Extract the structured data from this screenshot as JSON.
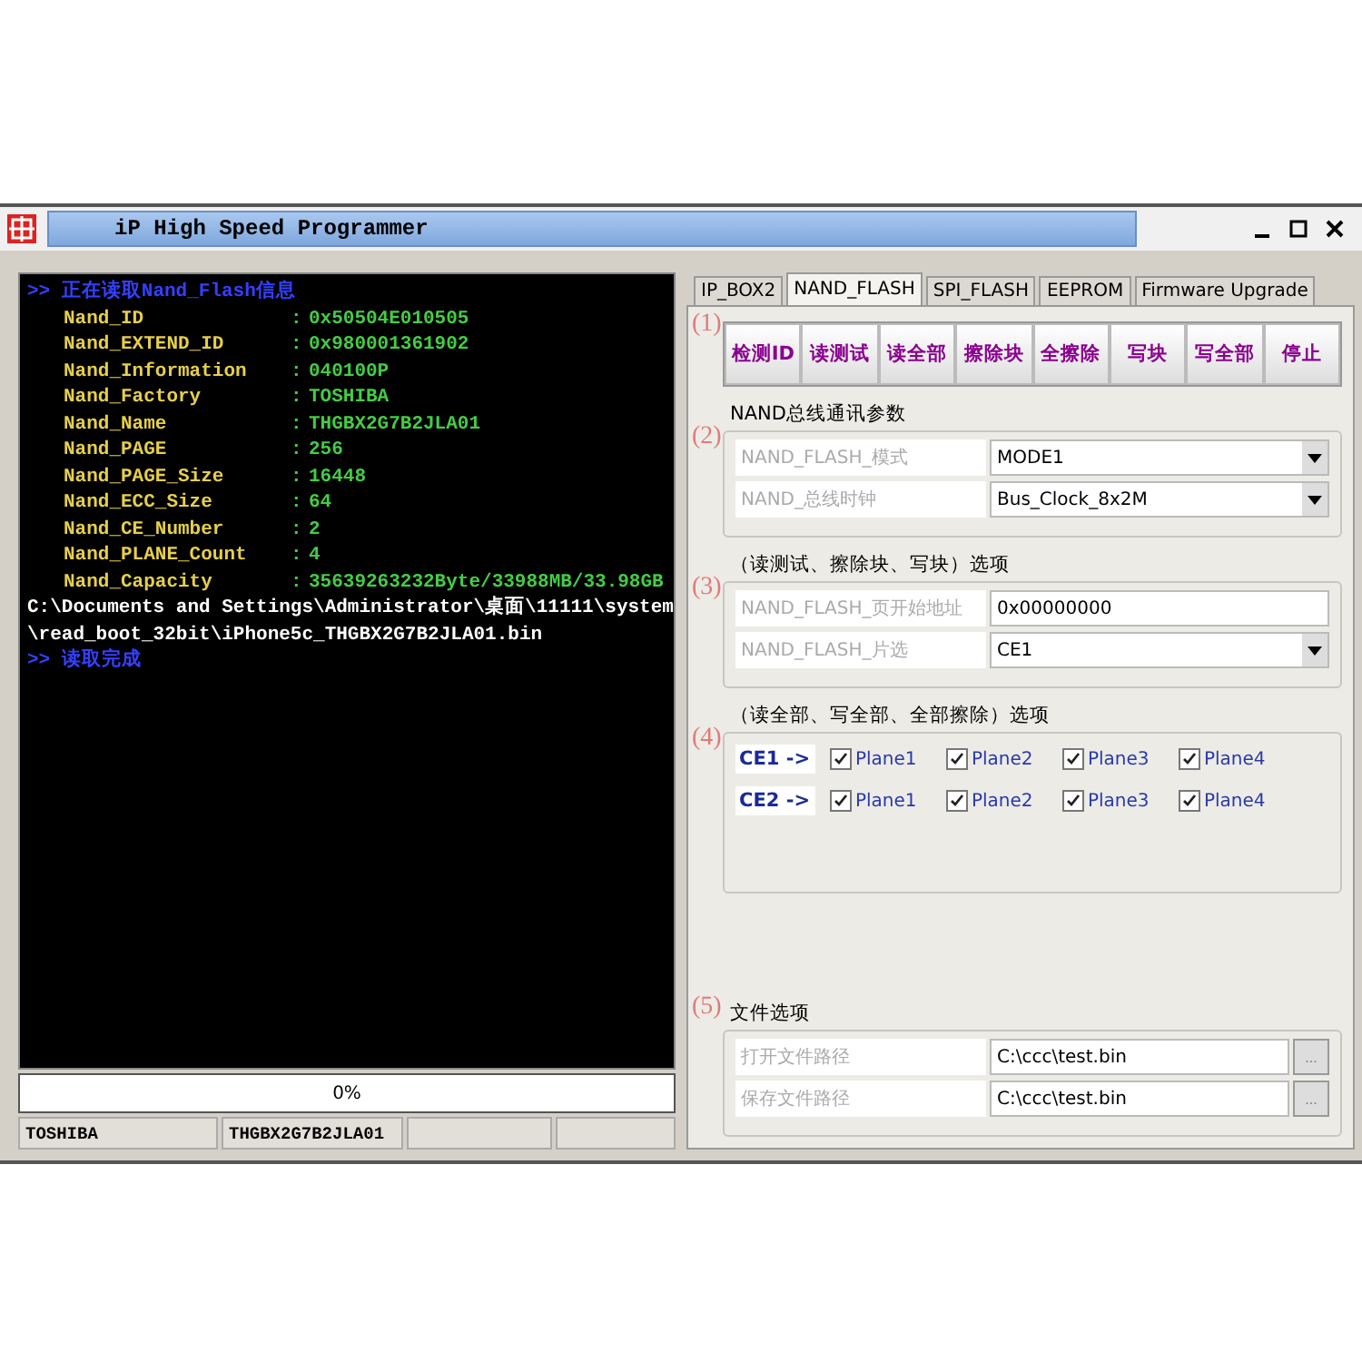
{
  "window": {
    "title": "iP High Speed Programmer"
  },
  "console": {
    "lines": [
      {
        "kind": "message",
        "text": ">> 正在读取Nand_Flash信息"
      },
      {
        "kind": "field",
        "label": "Nand_ID",
        "sep": ":",
        "value": "0x50504E010505"
      },
      {
        "kind": "field",
        "label": "Nand_EXTEND_ID",
        "sep": ":",
        "value": "0x980001361902"
      },
      {
        "kind": "field",
        "label": "Nand_Information",
        "sep": ":",
        "value": "040100P"
      },
      {
        "kind": "field",
        "label": "Nand_Factory",
        "sep": ":",
        "value": "TOSHIBA"
      },
      {
        "kind": "field",
        "label": "Nand_Name",
        "sep": ":",
        "value": "THGBX2G7B2JLA01"
      },
      {
        "kind": "field",
        "label": "Nand_PAGE",
        "sep": ":",
        "value": "256"
      },
      {
        "kind": "field",
        "label": "Nand_PAGE_Size",
        "sep": ":",
        "value": "16448"
      },
      {
        "kind": "field",
        "label": "Nand_ECC_Size",
        "sep": ":",
        "value": "64"
      },
      {
        "kind": "field",
        "label": "Nand_CE_Number",
        "sep": ":",
        "value": "2"
      },
      {
        "kind": "field",
        "label": "Nand_PLANE_Count",
        "sep": ":",
        "value": "4"
      },
      {
        "kind": "field",
        "label": "Nand_Capacity",
        "sep": ":",
        "value": "35639263232Byte/33988MB/33.98GB"
      },
      {
        "kind": "path",
        "text": "C:\\Documents and Settings\\Administrator\\桌面\\11111\\system"
      },
      {
        "kind": "path",
        "text": "\\read_boot_32bit\\iPhone5c_THGBX2G7B2JLA01.bin"
      },
      {
        "kind": "message",
        "text": ">> 读取完成"
      }
    ]
  },
  "progress": {
    "text": "0%",
    "level": 0
  },
  "status_bar": [
    "TOSHIBA",
    "THGBX2G7B2JLA01"
  ],
  "tabs": [
    {
      "label": "IP_BOX2",
      "selected": false
    },
    {
      "label": "NAND_FLASH",
      "selected": true
    },
    {
      "label": "SPI_FLASH",
      "selected": false
    },
    {
      "label": "EEPROM",
      "selected": false
    },
    {
      "label": "Firmware Upgrade",
      "selected": false
    }
  ],
  "actions": {
    "marker": "(1)",
    "buttons": [
      "检测ID",
      "读测试",
      "读全部",
      "擦除块",
      "全擦除",
      "写块",
      "写全部",
      "停止"
    ]
  },
  "bus": {
    "marker": "(2)",
    "title": "NAND总线通讯参数",
    "rows": [
      {
        "kind": "select",
        "label": "NAND_FLASH_模式",
        "value": "MODE1"
      },
      {
        "kind": "select",
        "label": "NAND_总线时钟",
        "value": "Bus_Clock_8x2M"
      }
    ]
  },
  "block_options": {
    "marker": "(3)",
    "title": "（读测试、擦除块、写块）选项",
    "rows": [
      {
        "kind": "input",
        "label": "NAND_FLASH_页开始地址",
        "value": "0x00000000"
      },
      {
        "kind": "select",
        "label": "NAND_FLASH_片选",
        "value": "CE1"
      }
    ]
  },
  "all_options": {
    "marker": "(4)",
    "title": "（读全部、写全部、全部擦除）选项",
    "chips": [
      {
        "label": "CE1 ->",
        "planes": [
          {
            "label": "Plane1",
            "checked": true
          },
          {
            "label": "Plane2",
            "checked": true
          },
          {
            "label": "Plane3",
            "checked": true
          },
          {
            "label": "Plane4",
            "checked": true
          }
        ]
      },
      {
        "label": "CE2 ->",
        "planes": [
          {
            "label": "Plane1",
            "checked": true
          },
          {
            "label": "Plane2",
            "checked": true
          },
          {
            "label": "Plane3",
            "checked": true
          },
          {
            "label": "Plane4",
            "checked": true
          }
        ]
      }
    ]
  },
  "file_options": {
    "marker": "(5)",
    "title": "文件选项",
    "rows": [
      {
        "kind": "file",
        "label": "打开文件路径",
        "value": "C:\\ccc\\test.bin",
        "button": "..."
      },
      {
        "kind": "file",
        "label": "保存文件路径",
        "value": "C:\\ccc\\test.bin",
        "button": "..."
      }
    ]
  }
}
